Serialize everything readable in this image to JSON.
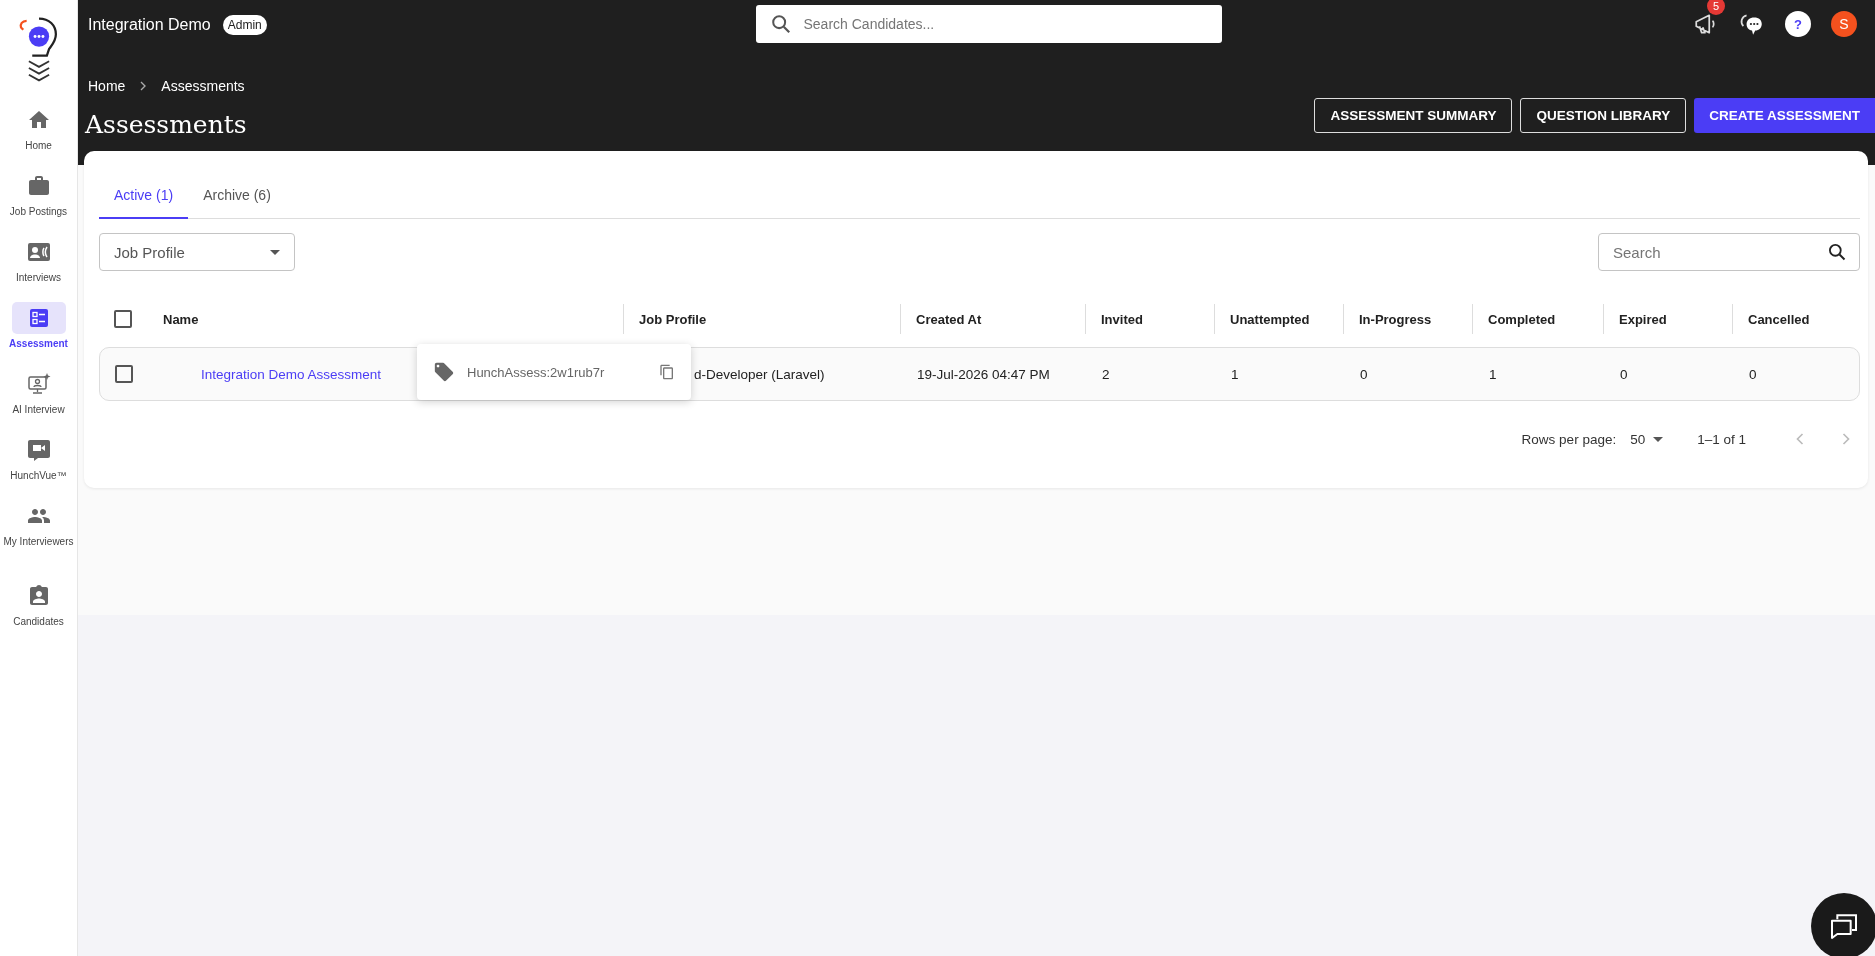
{
  "header": {
    "org_name": "Integration Demo",
    "role_badge": "Admin",
    "search": {
      "placeholder": "Search Candidates..."
    },
    "notification_count": "5",
    "help_label": "?",
    "avatar_initial": "S"
  },
  "sidebar": {
    "items": [
      {
        "label": "Home",
        "selected": false
      },
      {
        "label": "Job Postings",
        "selected": false
      },
      {
        "label": "Interviews",
        "selected": false
      },
      {
        "label": "Assessment",
        "selected": true
      },
      {
        "label": "AI Interview",
        "selected": false
      },
      {
        "label": "HunchVue™",
        "selected": false
      },
      {
        "label": "My Interviewers",
        "selected": false
      },
      {
        "label": "Candidates",
        "selected": false
      }
    ]
  },
  "breadcrumb": [
    "Home",
    "Assessments"
  ],
  "page_title": "Assessments",
  "actions": [
    {
      "label": "ASSESSMENT SUMMARY",
      "kind": "outlined"
    },
    {
      "label": "QUESTION LIBRARY",
      "kind": "outlined"
    },
    {
      "label": "CREATE ASSESSMENT",
      "kind": "primary"
    }
  ],
  "tabs": [
    {
      "label": "Active (1)",
      "selected": true
    },
    {
      "label": "Archive (6)",
      "selected": false
    }
  ],
  "filter": {
    "placeholder": "Job Profile"
  },
  "search": {
    "placeholder": "Search"
  },
  "table": {
    "header_checked": false,
    "columns": [
      "Name",
      "Job Profile",
      "Created At",
      "Invited",
      "Unattempted",
      "In-Progress",
      "Completed",
      "Expired",
      "Cancelled"
    ],
    "rows": [
      {
        "checked": false,
        "cells": [
          "Integration Demo Assessment",
          "d-Developer (Laravel)",
          "19-Jul-2026 04:47 PM",
          "2",
          "1",
          "0",
          "1",
          "0",
          "0"
        ]
      }
    ]
  },
  "tooltip": {
    "text": "HunchAssess:2w1rub7r"
  },
  "pagination": {
    "rows_per_page_label": "Rows per page:",
    "rows_per_page": "50",
    "range": "1–1 of 1"
  }
}
